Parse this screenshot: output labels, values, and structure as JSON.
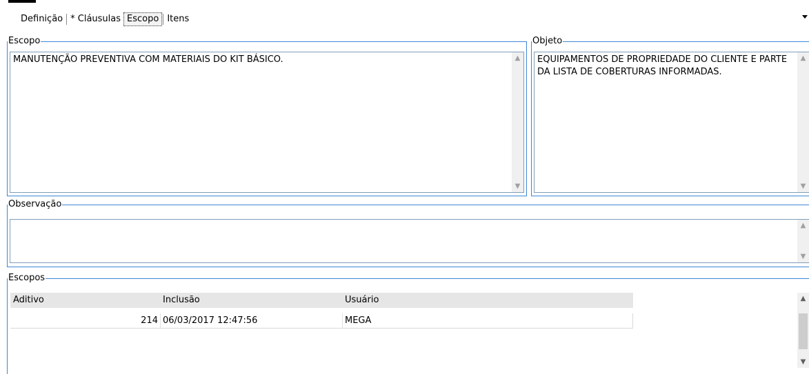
{
  "tabs": [
    {
      "label": "Definição",
      "active": false
    },
    {
      "label": "* Cláusulas",
      "active": false
    },
    {
      "label": "Escopo",
      "active": true
    },
    {
      "label": "Itens",
      "active": false
    }
  ],
  "escopo": {
    "legend": "Escopo",
    "text": "MANUTENÇÃO PREVENTIVA COM MATERIAIS DO KIT BÁSICO."
  },
  "objeto": {
    "legend": "Objeto",
    "text": "EQUIPAMENTOS DE PROPRIEDADE DO CLIENTE E PARTE DA LISTA DE COBERTURAS INFORMADAS."
  },
  "observacao": {
    "legend": "Observação",
    "text": ""
  },
  "escopos": {
    "legend": "Escopos",
    "columns": [
      "Aditivo",
      "Inclusão",
      "Usuário"
    ],
    "rows": [
      {
        "aditivo": "214",
        "inclusao": "06/03/2017 12:47:56",
        "usuario": "MEGA"
      }
    ]
  },
  "icons": {
    "scroll_up": "chevron-up-icon",
    "scroll_down": "chevron-down-icon",
    "tab_overflow": "dropdown-arrow-icon"
  },
  "colors": {
    "group_border": "#3d86d4",
    "grid_header_bg": "#e6e6e6"
  }
}
